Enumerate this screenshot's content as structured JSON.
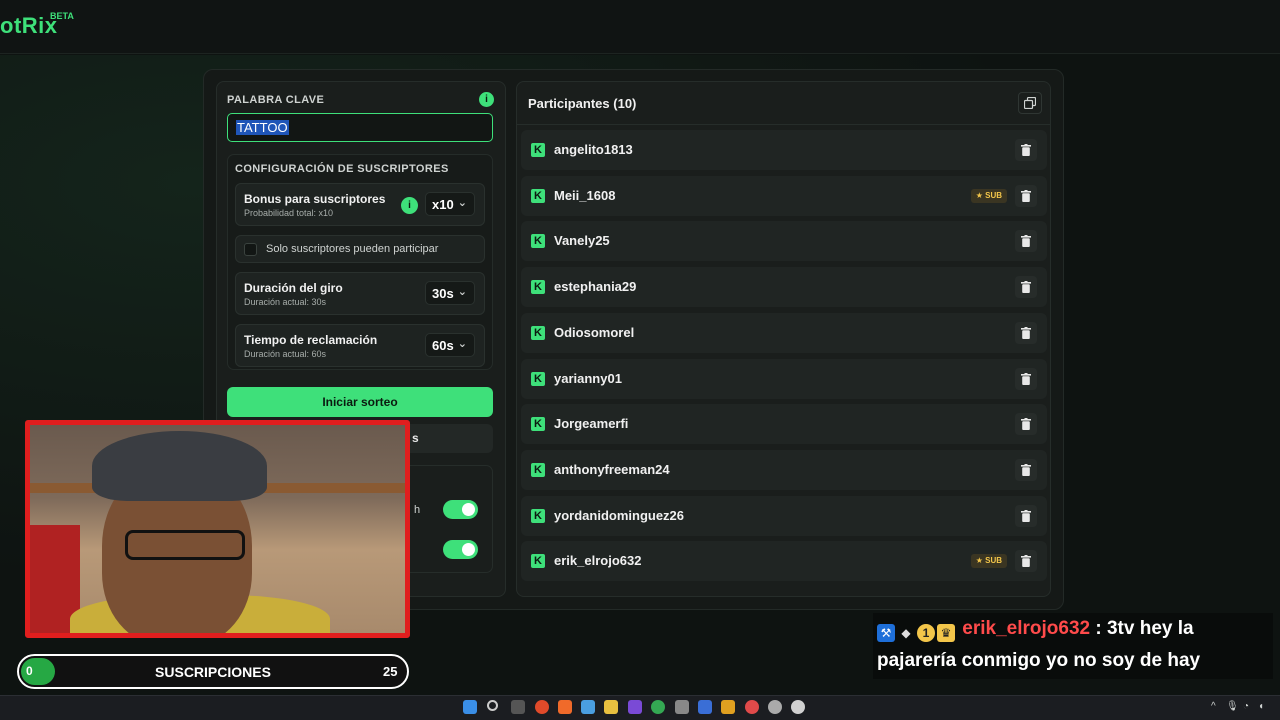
{
  "header": {
    "logo": "otRix",
    "beta": "BETA"
  },
  "keyword": {
    "label": "PALABRA CLAVE",
    "value": "TATTOO"
  },
  "subscribers_config": {
    "title": "CONFIGURACIÓN DE SUSCRIPTORES",
    "bonus": {
      "title": "Bonus para suscriptores",
      "subtitle": "Probabilidad total: x10",
      "value": "x10"
    },
    "only_subs": {
      "label": "Solo suscriptores pueden participar"
    },
    "spin_duration": {
      "title": "Duración del giro",
      "subtitle": "Duración actual: 30s",
      "value": "30s"
    },
    "claim_time": {
      "title": "Tiempo de reclamación",
      "subtitle": "Duración actual: 60s",
      "value": "60s"
    }
  },
  "actions": {
    "start_label": "Iniciar sorteo",
    "second_label_partial": "s"
  },
  "toggles": {
    "row1_partial_label": "h"
  },
  "participants": {
    "title": "Participantes (10)",
    "sub_badge": "SUB",
    "list": [
      {
        "name": "angelito1813",
        "sub": false
      },
      {
        "name": "Meii_1608",
        "sub": true
      },
      {
        "name": "Vanely25",
        "sub": false
      },
      {
        "name": "estephania29",
        "sub": false
      },
      {
        "name": "Odiosomorel",
        "sub": false
      },
      {
        "name": "yarianny01",
        "sub": false
      },
      {
        "name": "Jorgeamerfi",
        "sub": false
      },
      {
        "name": "anthonyfreeman24",
        "sub": false
      },
      {
        "name": "yordanidominguez26",
        "sub": false
      },
      {
        "name": "erik_elrojo632",
        "sub": true
      }
    ]
  },
  "stream_overlay": {
    "subs_goal": {
      "current": "0",
      "label": "SUSCRIPCIONES",
      "goal": "25"
    },
    "chat": {
      "user": "erik_elrojo632",
      "badge_number": "1",
      "message_line1": ": 3tv hey la",
      "message_line2": "pajarería conmigo yo no soy de hay"
    }
  },
  "colors": {
    "accent": "#3ee07a",
    "cam_border": "#e01e1e",
    "chat_user": "#ff4b4b"
  }
}
